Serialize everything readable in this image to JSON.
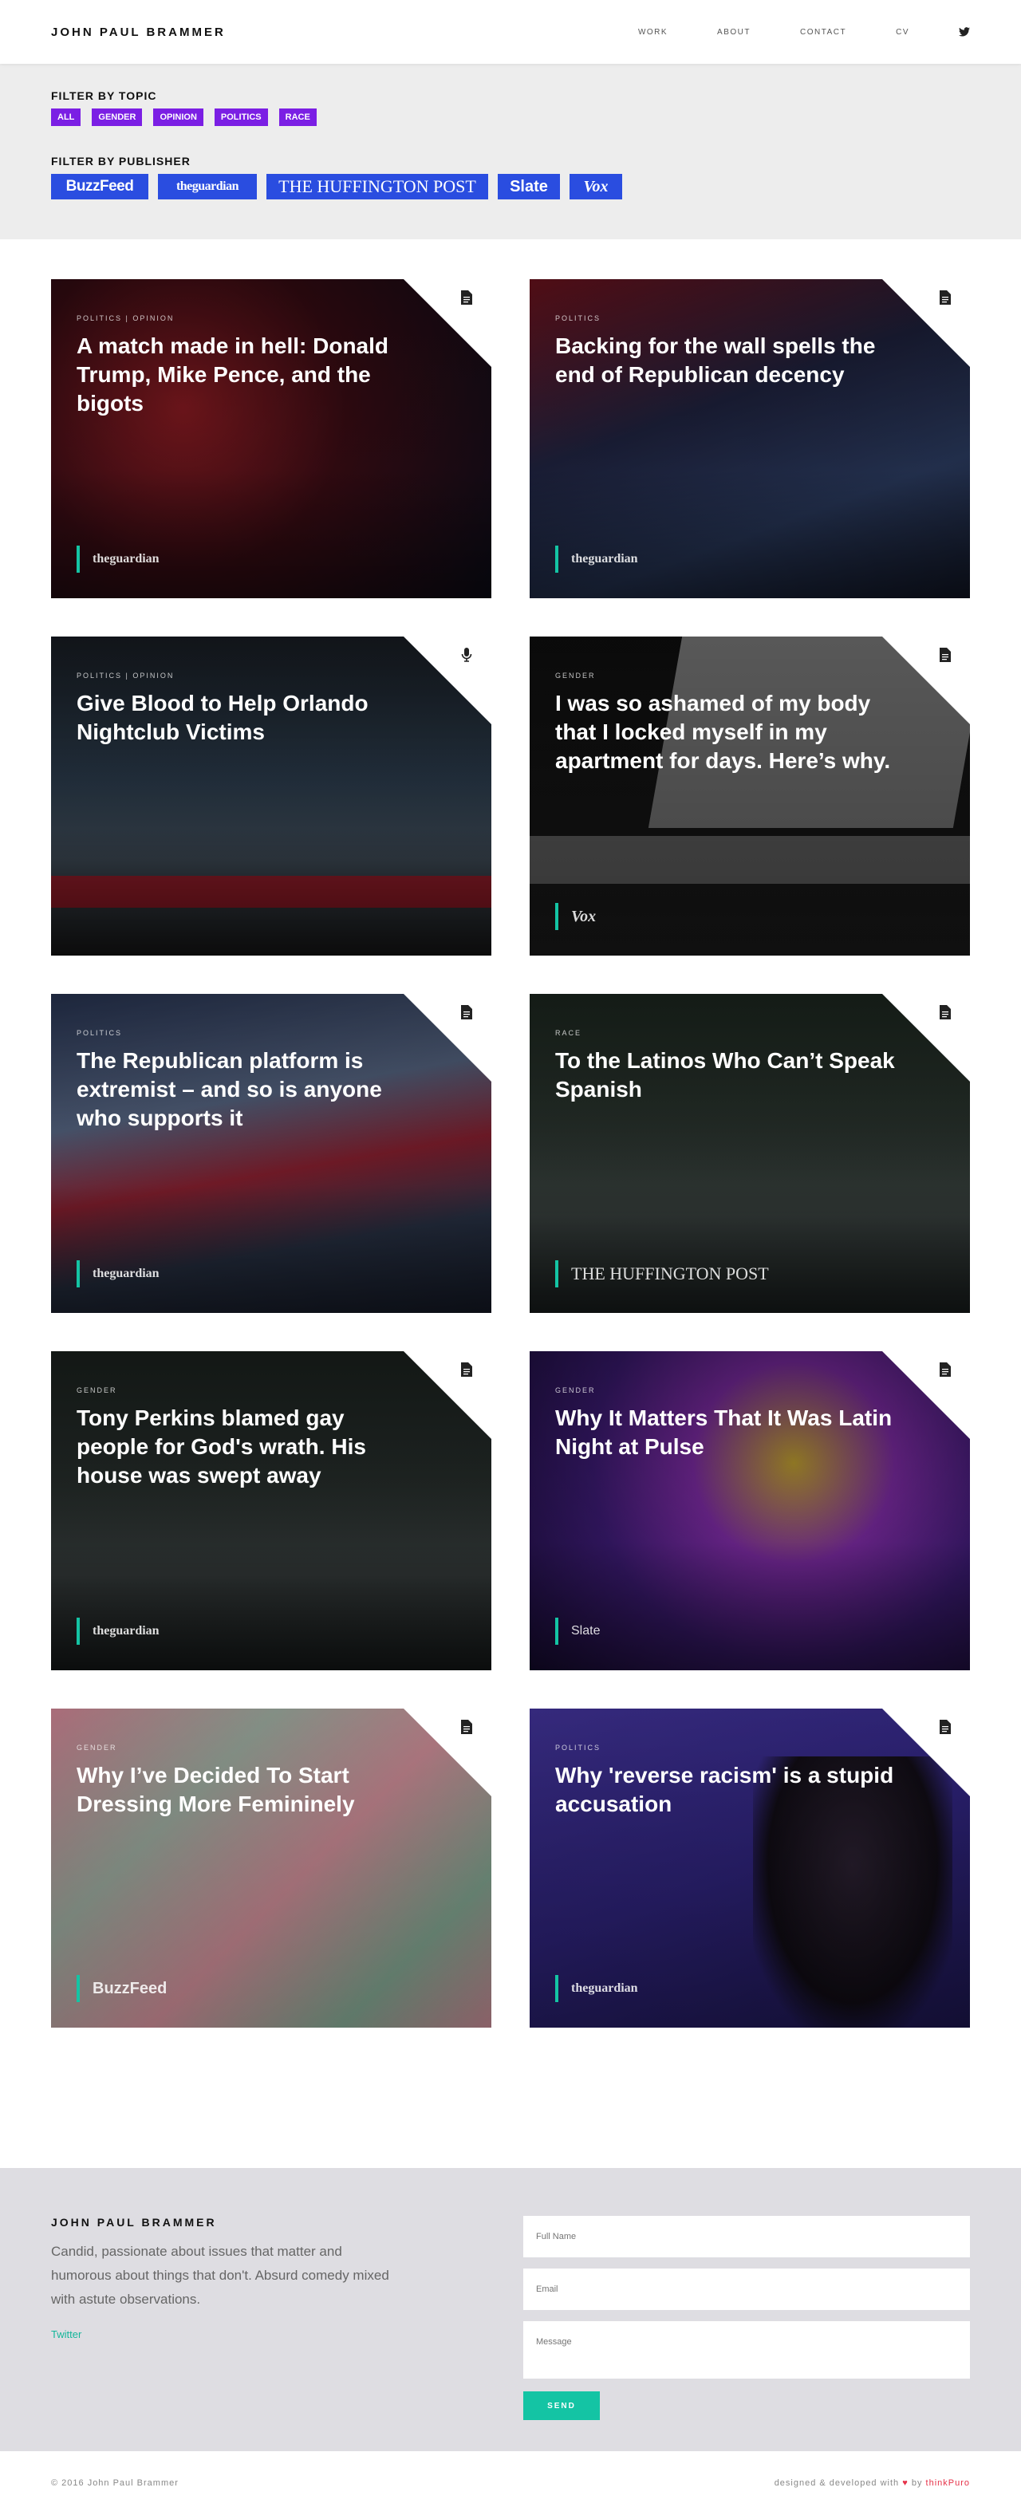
{
  "header": {
    "brand": "JOHN PAUL BRAMMER",
    "nav": [
      "WORK",
      "ABOUT",
      "CONTACT",
      "CV"
    ],
    "twitter_icon": "twitter-icon"
  },
  "filters": {
    "topic_label": "FILTER BY TOPIC",
    "topics": [
      "ALL",
      "GENDER",
      "OPINION",
      "POLITICS",
      "RACE"
    ],
    "publisher_label": "FILTER BY PUBLISHER",
    "publishers": [
      "BuzzFeed",
      "theguardian",
      "THE HUFFINGTON POST",
      "Slate",
      "Vox"
    ]
  },
  "cards": [
    {
      "category": "POLITICS | OPINION",
      "title": "A match made in hell: Donald Trump, Mike Pence, and the bigots",
      "publisher": "theguardian",
      "icon": "document-icon"
    },
    {
      "category": "POLITICS",
      "title": "Backing for the wall spells the end of Republican decency",
      "publisher": "theguardian",
      "icon": "document-icon"
    },
    {
      "category": "POLITICS | OPINION",
      "title": "Give Blood to Help Orlando Nightclub Victims",
      "publisher": "",
      "icon": "microphone-icon"
    },
    {
      "category": "GENDER",
      "title": "I was so ashamed of my body that I locked myself in my apartment for days. Here’s why.",
      "publisher": "Vox",
      "icon": "document-icon"
    },
    {
      "category": "POLITICS",
      "title": "The Republican platform is extremist – and so is anyone who supports it",
      "publisher": "theguardian",
      "icon": "document-icon"
    },
    {
      "category": "RACE",
      "title": "To the Latinos Who Can’t Speak Spanish",
      "publisher": "THE HUFFINGTON POST",
      "icon": "document-icon"
    },
    {
      "category": "GENDER",
      "title": "Tony Perkins blamed gay people for God's wrath. His house was swept away",
      "publisher": "theguardian",
      "icon": "document-icon"
    },
    {
      "category": "GENDER",
      "title": "Why It Matters That It Was Latin Night at Pulse",
      "publisher": "Slate",
      "icon": "document-icon"
    },
    {
      "category": "GENDER",
      "title": "Why I’ve Decided To Start Dressing More Femininely",
      "publisher": "BuzzFeed",
      "icon": "document-icon"
    },
    {
      "category": "POLITICS",
      "title": "Why 'reverse racism' is a stupid accusation",
      "publisher": "theguardian",
      "icon": "document-icon"
    }
  ],
  "contact": {
    "name": "JOHN PAUL BRAMMER",
    "bio": "Candid, passionate about issues that matter and humorous about things that don't. Absurd comedy mixed with astute observations.",
    "twitter": "Twitter",
    "placeholders": {
      "name": "Full Name",
      "email": "Email",
      "message": "Message"
    },
    "send": "SEND"
  },
  "footer": {
    "copyright": "© 2016 John Paul Brammer",
    "credit_prefix": "designed & developed with",
    "credit_by": "by",
    "studio": "thinkPuro"
  },
  "colors": {
    "accent_purple": "#7b1fe4",
    "publisher_blue": "#2a4de0",
    "teal": "#14c4a4"
  }
}
